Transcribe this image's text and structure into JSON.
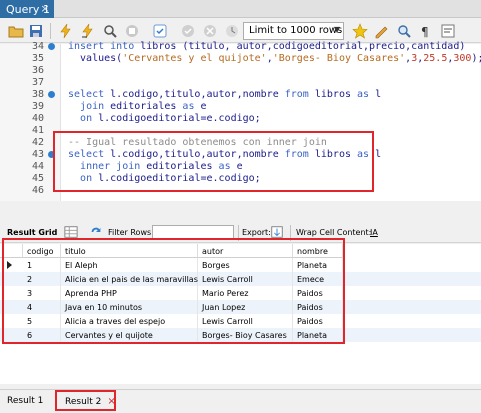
{
  "tabs": {
    "query_tab": "Query 1",
    "close_glyph": "×"
  },
  "toolbar": {
    "limit_select": "Limit to 1000 rows",
    "icons": [
      "open-file-icon",
      "save-icon",
      "execute-icon",
      "execute-current-icon",
      "explain-icon",
      "stop-icon",
      "toggle-continue-icon",
      "commit-icon",
      "rollback-icon",
      "autocommit-icon",
      "beautify-icon",
      "find-icon",
      "invisible-chars-icon",
      "word-wrap-icon"
    ]
  },
  "editor": {
    "lines": [
      {
        "n": "34",
        "marker": true,
        "code": "insert into libros (titulo, autor,codigoeditorial,precio,cantidad)"
      },
      {
        "n": "35",
        "marker": false,
        "code": "  values('Cervantes y el quijote','Borges- Bioy Casares',3,25.5,300);"
      },
      {
        "n": "36",
        "marker": false,
        "code": ""
      },
      {
        "n": "37",
        "marker": false,
        "code": ""
      },
      {
        "n": "38",
        "marker": true,
        "code": "select l.codigo,titulo,autor,nombre from libros as l"
      },
      {
        "n": "39",
        "marker": false,
        "code": "  join editoriales as e"
      },
      {
        "n": "40",
        "marker": false,
        "code": "  on l.codigoeditorial=e.codigo;"
      },
      {
        "n": "41",
        "marker": false,
        "code": ""
      },
      {
        "n": "42",
        "marker": false,
        "code": "-- Igual resultado obtenemos con inner join"
      },
      {
        "n": "43",
        "marker": true,
        "code": "select l.codigo,titulo,autor,nombre from libros as l"
      },
      {
        "n": "44",
        "marker": false,
        "code": "  inner join editoriales as e"
      },
      {
        "n": "45",
        "marker": false,
        "code": "  on l.codigoeditorial=e.codigo;"
      },
      {
        "n": "46",
        "marker": false,
        "code": ""
      }
    ]
  },
  "result_toolbar": {
    "result_grid": "Result Grid",
    "filter_rows": "Filter Rows:",
    "filter_value": "",
    "export": "Export:",
    "wrap": "Wrap Cell Content:",
    "wrap_glyph": "IA"
  },
  "grid": {
    "columns": [
      "codigo",
      "titulo",
      "autor",
      "nombre"
    ],
    "rows": [
      [
        "1",
        "El Aleph",
        "Borges",
        "Planeta"
      ],
      [
        "2",
        "Alicia en el pais de las maravillas",
        "Lewis Carroll",
        "Emece"
      ],
      [
        "3",
        "Aprenda PHP",
        "Mario Perez",
        "Paidos"
      ],
      [
        "4",
        "Java en 10 minutos",
        "Juan Lopez",
        "Paidos"
      ],
      [
        "5",
        "Alicia a traves del espejo",
        "Lewis Carroll",
        "Paidos"
      ],
      [
        "6",
        "Cervantes y el quijote",
        "Borges- Bioy Casares",
        "Planeta"
      ]
    ]
  },
  "bottom_tabs": {
    "result1": "Result 1",
    "result2": "Result 2",
    "close_glyph": "×"
  },
  "colors": {
    "accent": "#2f6ea5",
    "highlight": "#e0262b",
    "keyword": "#3a63c7",
    "string": "#b66a1f",
    "comment": "#8c8c8c"
  }
}
